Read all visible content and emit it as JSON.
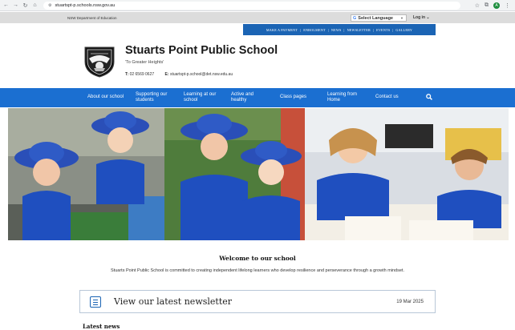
{
  "browser": {
    "url": "stuartspt-p.schools.nsw.gov.au"
  },
  "top_bar": {
    "dept_name": "NSW Department of Education",
    "select_language": "Select Language",
    "login": "Log in"
  },
  "quick_links": [
    "MAKE A PAYMENT",
    "ENROLMENT",
    "NEWS",
    "NEWSLETTER",
    "EVENTS",
    "GALLERY"
  ],
  "header": {
    "school_name": "Stuarts Point Public School",
    "motto": "'To Greater Heights'",
    "phone_label": "T:",
    "phone": "02 6569 0627",
    "email_label": "E:",
    "email": "stuartspt-p.school@det.nsw.edu.au"
  },
  "main_nav": [
    {
      "line1": "About our school",
      "line2": ""
    },
    {
      "line1": "Supporting our",
      "line2": "students"
    },
    {
      "line1": "Learning at our",
      "line2": "school"
    },
    {
      "line1": "Active and",
      "line2": "healthy"
    },
    {
      "line1": "Class pages",
      "line2": ""
    },
    {
      "line1": "Learning from",
      "line2": "Home"
    },
    {
      "line1": "Contact us",
      "line2": ""
    }
  ],
  "welcome": {
    "title": "Welcome to our school",
    "text": "Stuarts Point Public School is committed to creating independent lifelong learners who develop resilience and perseverance through a growth mindset."
  },
  "newsletter": {
    "label": "View our latest newsletter",
    "date": "19 Mar 2025"
  },
  "latest_news": "Latest news",
  "icons": {
    "search": "search-icon",
    "newsletter": "newsletter-icon"
  },
  "colors": {
    "nav_blue": "#1b6fd1",
    "quick_links_blue": "#1b64b4",
    "uniform_blue": "#1f4fbf"
  }
}
